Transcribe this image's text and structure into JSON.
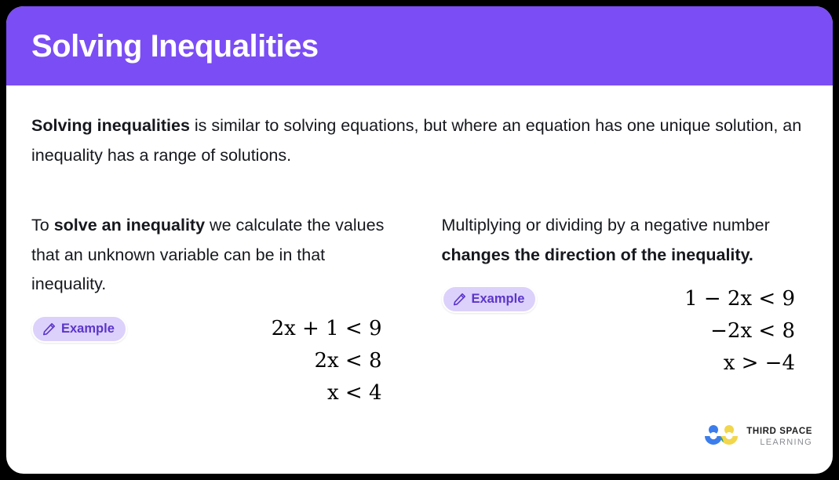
{
  "colors": {
    "header_purple": "#7B4DF5",
    "badge_fill": "#DCD1FB",
    "badge_text": "#5B35C9",
    "body_text": "#16181d",
    "page_background": "#000000",
    "card_background": "#ffffff",
    "logo_blue": "#3B7DEC",
    "logo_yellow": "#F2D64B",
    "logo_green": "#37A06A"
  },
  "header": {
    "title": "Solving Inequalities"
  },
  "intro": {
    "bold_lead": "Solving inequalities",
    "rest": " is similar to solving equations, but where an equation has one unique solution, an inequality has a range of solutions."
  },
  "columns": [
    {
      "text_parts": {
        "part1": "To ",
        "bold": "solve an inequality",
        "part2": " we calculate the values that an unknown variable can be in that inequality."
      },
      "badge": {
        "label": "Example",
        "icon": "pencil-icon"
      },
      "equations": [
        "2x + 1 < 9",
        "2x < 8",
        "x < 4"
      ]
    },
    {
      "text_parts": {
        "part1": "Multiplying or dividing by a negative number ",
        "bold": "changes the direction of the inequality.",
        "part2": ""
      },
      "badge": {
        "label": "Example",
        "icon": "pencil-icon"
      },
      "equations": [
        "1 − 2x < 9",
        "−2x < 8",
        "x > −4"
      ]
    }
  ],
  "logo": {
    "line1": "THIRD SPACE",
    "line2": "LEARNING",
    "mark": "two-figures-logo-mark"
  }
}
